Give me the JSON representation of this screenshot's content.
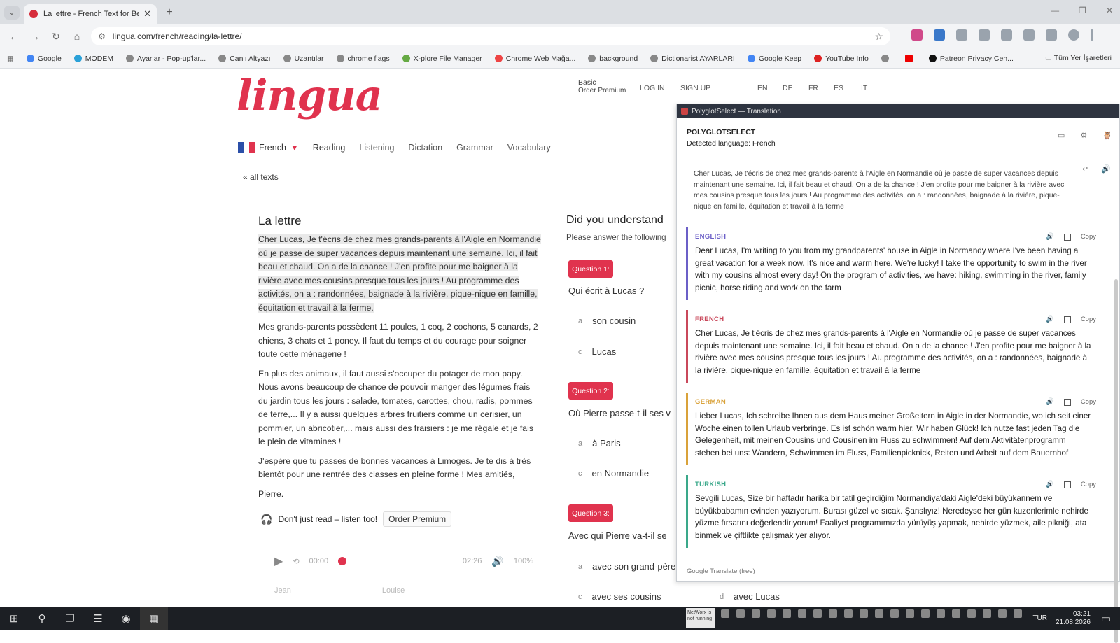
{
  "browser": {
    "tab_title": "La lettre - French Text for Beginners",
    "url": "lingua.com/french/reading/la-lettre/",
    "bookmarks": [
      "Google",
      "MODEM",
      "Ayarlar - Pop-up'lar...",
      "Canlı Altyazı",
      "Uzantılar",
      "chrome flags",
      "X-plore File Manager",
      "Chrome Web Mağa...",
      "background",
      "Dictionarist AYARLARI",
      "Google Keep",
      "YouTube Info",
      "Patreon Privacy Cen..."
    ],
    "bookmarks_more": "Tüm Yer İşaretleri"
  },
  "site": {
    "logo": "lingua",
    "plan_label": "Basic",
    "plan_sub": "Order Premium",
    "login": "LOG IN",
    "signup": "SIGN UP",
    "site_langs": [
      "EN",
      "DE",
      "FR",
      "ES",
      "IT"
    ],
    "language": "French",
    "nav": [
      "Reading",
      "Listening",
      "Dictation",
      "Grammar",
      "Vocabulary"
    ],
    "all_texts": "« all texts"
  },
  "article": {
    "title": "La lettre",
    "paragraphs": [
      "Cher Lucas, Je t'écris de chez mes grands-parents à l'Aigle en Normandie où je passe de super vacances depuis maintenant une semaine. Ici, il fait beau et chaud. On a de la chance ! J'en profite pour me baigner à la rivière avec mes cousins presque tous les jours ! Au programme des activités, on a : randonnées, baignade à la rivière, pique-nique en famille, équitation et travail à la ferme.",
      "Mes grands-parents possèdent 11 poules, 1 coq, 2 cochons, 5 canards, 2 chiens, 3 chats et 1 poney. Il faut du temps et du courage pour soigner toute cette ménagerie !",
      "En plus des animaux, il faut aussi s'occuper du potager de mon papy. Nous avons beaucoup de chance de pouvoir manger des légumes frais du jardin tous les jours : salade, tomates, carottes, chou, radis, pommes de terre,... Il y a aussi quelques arbres fruitiers comme un cerisier, un pommier, un abricotier,... mais aussi des fraisiers : je me régale et je fais le plein de vitamines !",
      "J'espère que tu passes de bonnes vacances à Limoges. Je te dis à très bientôt pour une rentrée des classes en pleine forme ! Mes amitiés,",
      "Pierre."
    ],
    "listen_text": "Don't just read – listen too!",
    "listen_button": "Order Premium",
    "time_start": "00:00",
    "time_end": "02:26",
    "speed": "100%",
    "voice1": "Jean",
    "voice2": "Louise"
  },
  "quiz": {
    "heading": "Did you understand",
    "sub": "Please answer the following",
    "questions": [
      {
        "badge": "Question 1:",
        "text": "Qui écrit à Lucas ?",
        "opts": [
          [
            "a",
            "son cousin"
          ],
          [
            "c",
            "Lucas"
          ]
        ]
      },
      {
        "badge": "Question 2:",
        "text": "Où Pierre passe-t-il ses v",
        "opts": [
          [
            "a",
            "à Paris"
          ],
          [
            "c",
            "en Normandie"
          ]
        ]
      },
      {
        "badge": "Question 3:",
        "text": "Avec qui Pierre va-t-il se",
        "opts": [
          [
            "a",
            "avec son grand-père"
          ],
          [
            "c",
            "avec ses cousins"
          ],
          [
            "d",
            "avec Lucas"
          ]
        ]
      }
    ]
  },
  "panel": {
    "titlebar": "PolyglotSelect — Translation",
    "brand": "POLYGLOTSELECT",
    "detected": "Detected language: French",
    "source": "Cher Lucas, Je t'écris de chez mes grands-parents à l'Aigle en Normandie où je passe de super vacances depuis maintenant une semaine. Ici, il fait beau et chaud. On a de la chance ! J'en profite pour me baigner à la rivière avec mes cousins presque tous les jours ! Au programme des activités, on a : randonnées, baignade à la rivière, pique-nique en famille, équitation et travail à la ferme",
    "copy": "Copy",
    "cards": [
      {
        "lang": "ENGLISH",
        "color": "#6b5fc7",
        "text": "Dear Lucas, I'm writing to you from my grandparents' house in Aigle in Normandy where I've been having a great vacation for a week now. It's nice and warm here. We're lucky! I take the opportunity to swim in the river with my cousins almost every day! On the program of activities, we have: hiking, swimming in the river, family picnic, horse riding and work on the farm"
      },
      {
        "lang": "FRENCH",
        "color": "#c9485b",
        "text": "Cher Lucas, Je t'écris de chez mes grands-parents à l'Aigle en Normandie où je passe de super vacances depuis maintenant une semaine. Ici, il fait beau et chaud. On a de la chance ! J'en profite pour me baigner à la rivière avec mes cousins presque tous les jours ! Au programme des activités, on a : randonnées, baignade à la rivière, pique-nique en famille, équitation et travail à la ferme"
      },
      {
        "lang": "GERMAN",
        "color": "#d9a23a",
        "text": "Lieber Lucas, Ich schreibe Ihnen aus dem Haus meiner Großeltern in Aigle in der Normandie, wo ich seit einer Woche einen tollen Urlaub verbringe. Es ist schön warm hier. Wir haben Glück! Ich nutze fast jeden Tag die Gelegenheit, mit meinen Cousins und Cousinen im Fluss zu schwimmen! Auf dem Aktivitätenprogramm stehen bei uns: Wandern, Schwimmen im Fluss, Familienpicknick, Reiten und Arbeit auf dem Bauernhof"
      },
      {
        "lang": "TURKISH",
        "color": "#3aa88a",
        "text": "Sevgili Lucas, Size bir haftadır harika bir tatil geçirdiğim Normandiya'daki Aigle'deki büyükannem ve büyükbabamın evinden yazıyorum. Burası güzel ve sıcak. Şanslıyız! Neredeyse her gün kuzenlerimle nehirde yüzme fırsatını değerlendiriyorum! Faaliyet programımızda yürüyüş yapmak, nehirde yüzmek, aile pikniği, ata binmek ve çiftlikte çalışmak yer alıyor."
      }
    ],
    "footer": "Google Translate (free)"
  },
  "taskbar": {
    "networx": "NetWorx is not running",
    "lang": "TUR",
    "time": "03:21",
    "date": "21.08.2026"
  }
}
